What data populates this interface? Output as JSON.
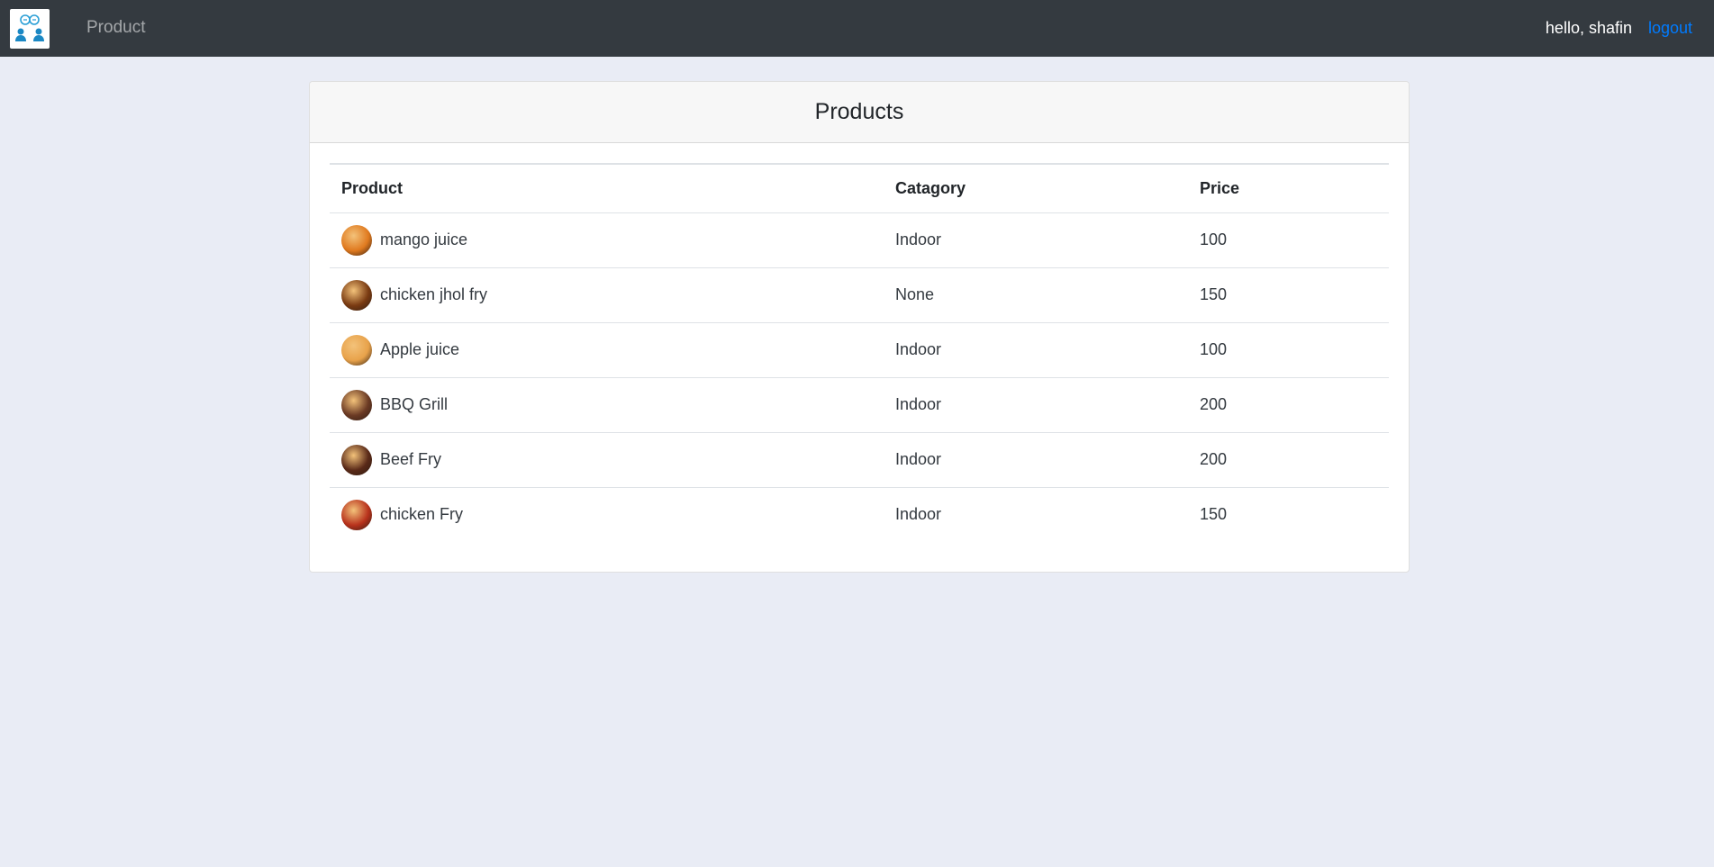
{
  "navbar": {
    "brand_icon": "team-chat-logo-icon",
    "nav_product": "Product",
    "greeting": "hello, shafin",
    "logout": "logout"
  },
  "card": {
    "title": "Products"
  },
  "table": {
    "headers": [
      "Product",
      "Catagory",
      "Price"
    ],
    "rows": [
      {
        "name": "mango juice",
        "category": "Indoor",
        "price": "100",
        "thumb_color": "#e07a1f"
      },
      {
        "name": "chicken jhol fry",
        "category": "None",
        "price": "150",
        "thumb_color": "#7a3b12"
      },
      {
        "name": "Apple juice",
        "category": "Indoor",
        "price": "100",
        "thumb_color": "#e8a24a"
      },
      {
        "name": "BBQ Grill",
        "category": "Indoor",
        "price": "200",
        "thumb_color": "#6b3a24"
      },
      {
        "name": "Beef Fry",
        "category": "Indoor",
        "price": "200",
        "thumb_color": "#5a2a18"
      },
      {
        "name": "chicken Fry",
        "category": "Indoor",
        "price": "150",
        "thumb_color": "#b8321c"
      }
    ]
  },
  "colors": {
    "navbar_bg": "#343a40",
    "page_bg": "#e9ecf5",
    "link_blue": "#007bff"
  }
}
